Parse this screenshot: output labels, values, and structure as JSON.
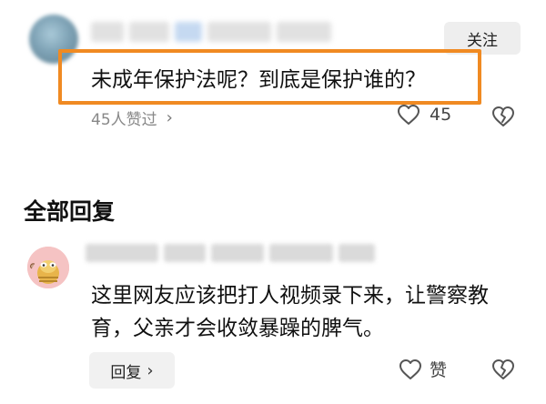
{
  "comment": {
    "follow_label": "关注",
    "text": "未成年保护法呢？到底是保护谁的？",
    "likers_label": "45人赞过",
    "likers_chevron": "›",
    "like_count": "45"
  },
  "replies": {
    "section_title": "全部回复",
    "items": [
      {
        "text": "这里网友应该把打人视频录下来，让警察教育，父亲才会收敛暴躁的脾气。",
        "reply_label": "回复",
        "reply_chevron": "›",
        "like_label": "赞"
      }
    ]
  },
  "colors": {
    "highlight": "#f08a22",
    "muted_text": "#888888",
    "button_bg": "#eeeeee"
  },
  "icons": [
    "heart-outline-icon",
    "broken-heart-icon",
    "chevron-right-icon",
    "cartoon-avatar-icon"
  ]
}
